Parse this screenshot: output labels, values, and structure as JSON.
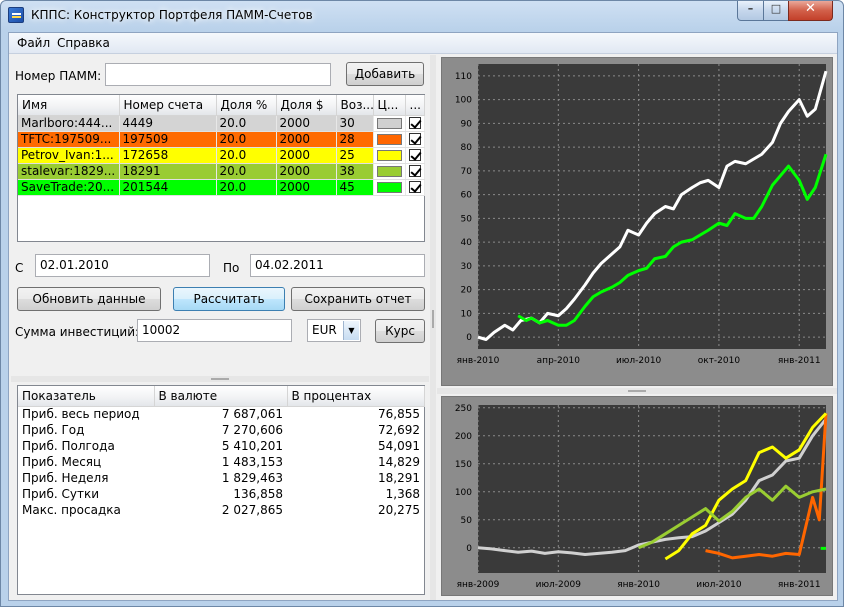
{
  "window": {
    "title": "КППС: Конструктор Портфеля ПАММ-Счетов"
  },
  "menu": [
    "Файл",
    "Справка"
  ],
  "pamm": {
    "label": "Номер ПАММ:",
    "value": "",
    "add_label": "Добавить"
  },
  "table": {
    "columns": [
      "Имя",
      "Номер счета",
      "Доля %",
      "Доля $",
      "Воз...",
      "Ц...",
      "..."
    ],
    "rows": [
      {
        "name": "Marlboro:444...",
        "account": "4449",
        "share_pct": "20.0",
        "share_usd": "2000",
        "age": "30",
        "color": "#d0d0d0",
        "row_bg": "#d4d4d4",
        "checked": true
      },
      {
        "name": "TFTC:197509...",
        "account": "197509",
        "share_pct": "20.0",
        "share_usd": "2000",
        "age": "28",
        "color": "#ff6600",
        "row_bg": "#ff6a00",
        "checked": true
      },
      {
        "name": "Petrov_Ivan:1...",
        "account": "172658",
        "share_pct": "20.0",
        "share_usd": "2000",
        "age": "25",
        "color": "#ffff00",
        "row_bg": "#ffff00",
        "checked": true
      },
      {
        "name": "stalevar:1829...",
        "account": "18291",
        "share_pct": "20.0",
        "share_usd": "2000",
        "age": "38",
        "color": "#9acd32",
        "row_bg": "#99cc33",
        "checked": true
      },
      {
        "name": "SaveTrade:20...",
        "account": "201544",
        "share_pct": "20.0",
        "share_usd": "2000",
        "age": "45",
        "color": "#00ff00",
        "row_bg": "#00ff00",
        "checked": true
      }
    ]
  },
  "dates": {
    "from_label": "С",
    "from": "02.01.2010",
    "to_label": "По",
    "to": "04.02.2011"
  },
  "buttons": {
    "refresh": "Обновить данные",
    "calculate": "Рассчитать",
    "save": "Сохранить отчет",
    "rate": "Курс"
  },
  "investment": {
    "label": "Сумма инвестиций:",
    "value": "10002",
    "currency": "EUR"
  },
  "stats": {
    "columns": [
      "Показатель",
      "В валюте",
      "В процентах"
    ],
    "rows": [
      [
        "Приб. весь период",
        "7 687,061",
        "76,855"
      ],
      [
        "Приб. Год",
        "7 270,606",
        "72,692"
      ],
      [
        "Приб. Полгода",
        "5 410,201",
        "54,091"
      ],
      [
        "Приб. Месяц",
        "1 483,153",
        "14,829"
      ],
      [
        "Приб. Неделя",
        "1 829,463",
        "18,291"
      ],
      [
        "Приб. Сутки",
        "136,858",
        "1,368"
      ],
      [
        "Макс. просадка",
        "2 027,865",
        "20,275"
      ]
    ]
  },
  "chart_data": [
    {
      "type": "line",
      "xlim": [
        0,
        13
      ],
      "ylim": [
        -5,
        115
      ],
      "x_ticks": [
        {
          "x": 0,
          "label": "янв-2010"
        },
        {
          "x": 3,
          "label": "апр-2010"
        },
        {
          "x": 6,
          "label": "июл-2010"
        },
        {
          "x": 9,
          "label": "окт-2010"
        },
        {
          "x": 12,
          "label": "янв-2011"
        }
      ],
      "y_ticks": [
        0,
        10,
        20,
        30,
        40,
        50,
        60,
        70,
        80,
        90,
        100,
        110
      ],
      "series": [
        {
          "color": "#ffffff",
          "x": [
            0,
            0.3,
            0.6,
            1,
            1.3,
            1.6,
            2,
            2.3,
            2.6,
            3,
            3.3,
            3.6,
            4,
            4.3,
            4.6,
            5,
            5.3,
            5.6,
            6,
            6.3,
            6.6,
            7,
            7.3,
            7.6,
            8,
            8.3,
            8.6,
            9,
            9.3,
            9.6,
            10,
            10.3,
            10.6,
            11,
            11.3,
            11.6,
            12,
            12.3,
            12.6,
            13
          ],
          "y": [
            0,
            -1,
            2,
            5,
            3,
            7,
            8,
            6,
            10,
            9,
            12,
            16,
            22,
            27,
            31,
            35,
            38,
            45,
            43,
            48,
            52,
            55,
            54,
            60,
            63,
            65,
            66,
            63,
            72,
            74,
            73,
            75,
            77,
            82,
            90,
            95,
            100,
            93,
            96,
            112
          ]
        },
        {
          "color": "#00ff00",
          "x": [
            1.5,
            1.8,
            2,
            2.3,
            2.6,
            3,
            3.3,
            3.6,
            4,
            4.3,
            4.6,
            5,
            5.3,
            5.6,
            6,
            6.3,
            6.6,
            7,
            7.3,
            7.6,
            8,
            8.3,
            8.6,
            9,
            9.3,
            9.6,
            10,
            10.3,
            10.6,
            11,
            11.3,
            11.6,
            12,
            12.3,
            12.6,
            13
          ],
          "y": [
            9,
            7,
            8,
            6,
            7,
            5,
            5,
            7,
            13,
            17,
            19,
            21,
            23,
            26,
            28,
            29,
            33,
            34,
            38,
            40,
            41,
            43,
            45,
            48,
            47,
            52,
            50,
            50,
            55,
            64,
            68,
            72,
            66,
            58,
            63,
            77
          ]
        }
      ]
    },
    {
      "type": "line",
      "xlim": [
        0,
        26
      ],
      "ylim": [
        -45,
        255
      ],
      "x_ticks": [
        {
          "x": 0,
          "label": "янв-2009"
        },
        {
          "x": 6,
          "label": "июл-2009"
        },
        {
          "x": 12,
          "label": "янв-2010"
        },
        {
          "x": 18,
          "label": "июл-2010"
        },
        {
          "x": 24,
          "label": "янв-2011"
        }
      ],
      "y_ticks": [
        0,
        50,
        100,
        150,
        200,
        250
      ],
      "series": [
        {
          "color": "#d0d0d0",
          "x": [
            0,
            1,
            2,
            3,
            4,
            5,
            6,
            7,
            8,
            9,
            10,
            11,
            12,
            13,
            14,
            15,
            16,
            17,
            18,
            19,
            20,
            21,
            22,
            23,
            24,
            25,
            26
          ],
          "y": [
            0,
            -2,
            -5,
            -8,
            -6,
            -10,
            -7,
            -9,
            -12,
            -10,
            -8,
            -5,
            5,
            10,
            15,
            18,
            20,
            30,
            45,
            60,
            85,
            120,
            130,
            155,
            160,
            200,
            230
          ]
        },
        {
          "color": "#ff6600",
          "x": [
            17,
            18,
            19,
            20,
            21,
            22,
            23,
            24,
            25,
            25.5,
            26
          ],
          "y": [
            -5,
            -10,
            -18,
            -15,
            -12,
            -15,
            -10,
            -12,
            90,
            50,
            240
          ]
        },
        {
          "color": "#ffff00",
          "x": [
            14,
            15,
            16,
            17,
            18,
            19,
            20,
            21,
            22,
            23,
            24,
            25,
            26
          ],
          "y": [
            -20,
            -5,
            25,
            40,
            85,
            105,
            120,
            170,
            180,
            160,
            175,
            215,
            240
          ]
        },
        {
          "color": "#9acd32",
          "x": [
            12,
            13,
            14,
            15,
            16,
            17,
            18,
            19,
            20,
            21,
            22,
            23,
            24,
            25,
            26
          ],
          "y": [
            0,
            10,
            25,
            40,
            55,
            70,
            48,
            65,
            90,
            105,
            85,
            110,
            90,
            100,
            105
          ]
        },
        {
          "color": "#00ff00",
          "x": [
            25.6,
            26
          ],
          "y": [
            -1,
            -1
          ]
        }
      ]
    }
  ]
}
